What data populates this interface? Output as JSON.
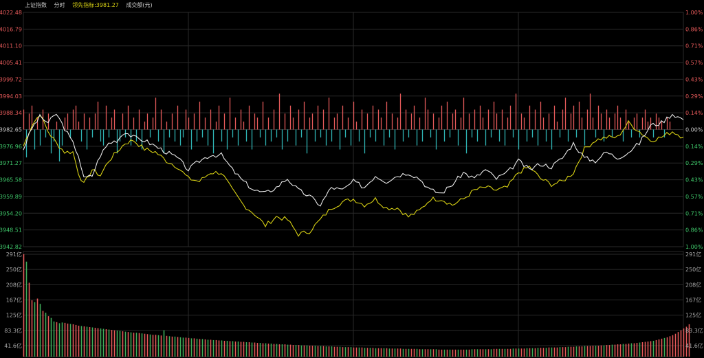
{
  "header": {
    "index_name": "上证指数",
    "mode": "分时",
    "leader_label": "领先指标:",
    "leader_value": "3981.27",
    "volume_label": "成交额(元)"
  },
  "colors": {
    "up": "#e65a5a",
    "down": "#2fb4b4",
    "neutral": "#cccccc",
    "price_line": "#e8e8e8",
    "leader_line": "#d9d214",
    "grid": "#2a2a2a",
    "header_text": "#cccccc",
    "leader_text": "#d9d214"
  },
  "chart_data": [
    {
      "type": "line",
      "name": "intraday",
      "prev_close": 3982.65,
      "ylim": [
        3942.82,
        4022.48
      ],
      "y_ticks_left": [
        "4022.48",
        "4016.79",
        "4011.10",
        "4005.41",
        "3999.72",
        "3994.03",
        "3988.34",
        "3982.65",
        "3976.96",
        "3971.27",
        "3965.58",
        "3959.89",
        "3954.20",
        "3948.51",
        "3942.82"
      ],
      "y_ticks_right": [
        "1.00%",
        "0.86%",
        "0.71%",
        "0.57%",
        "0.43%",
        "0.29%",
        "0.14%",
        "0.00%",
        "0.14%",
        "0.29%",
        "0.43%",
        "0.57%",
        "0.71%",
        "0.86%",
        "1.00%"
      ],
      "price_anchors": [
        [
          0,
          3976
        ],
        [
          3,
          3983
        ],
        [
          6,
          3987
        ],
        [
          9,
          3985
        ],
        [
          12,
          3988
        ],
        [
          15,
          3983
        ],
        [
          18,
          3978
        ],
        [
          20,
          3974
        ],
        [
          22,
          3966
        ],
        [
          25,
          3967
        ],
        [
          28,
          3974
        ],
        [
          31,
          3978
        ],
        [
          34,
          3979
        ],
        [
          37,
          3982
        ],
        [
          40,
          3980
        ],
        [
          44,
          3979
        ],
        [
          48,
          3977
        ],
        [
          52,
          3975
        ],
        [
          56,
          3973
        ],
        [
          60,
          3969
        ],
        [
          64,
          3972
        ],
        [
          68,
          3974
        ],
        [
          72,
          3974
        ],
        [
          76,
          3969
        ],
        [
          80,
          3965
        ],
        [
          84,
          3962
        ],
        [
          88,
          3961
        ],
        [
          92,
          3963
        ],
        [
          96,
          3966
        ],
        [
          100,
          3962
        ],
        [
          104,
          3960
        ],
        [
          108,
          3957
        ],
        [
          112,
          3963
        ],
        [
          116,
          3962
        ],
        [
          120,
          3965
        ],
        [
          124,
          3963
        ],
        [
          128,
          3967
        ],
        [
          132,
          3965
        ],
        [
          136,
          3967
        ],
        [
          140,
          3968
        ],
        [
          144,
          3966
        ],
        [
          148,
          3962
        ],
        [
          152,
          3961
        ],
        [
          156,
          3964
        ],
        [
          160,
          3968
        ],
        [
          164,
          3966
        ],
        [
          168,
          3969
        ],
        [
          172,
          3966
        ],
        [
          176,
          3968
        ],
        [
          180,
          3972
        ],
        [
          184,
          3969
        ],
        [
          188,
          3971
        ],
        [
          192,
          3970
        ],
        [
          196,
          3973
        ],
        [
          200,
          3978
        ],
        [
          204,
          3973
        ],
        [
          208,
          3972
        ],
        [
          212,
          3975
        ],
        [
          216,
          3973
        ],
        [
          220,
          3975
        ],
        [
          224,
          3978
        ],
        [
          228,
          3984
        ],
        [
          232,
          3985
        ],
        [
          236,
          3988
        ],
        [
          240,
          3986
        ]
      ],
      "leader_anchors": [
        [
          0,
          3977
        ],
        [
          3,
          3984
        ],
        [
          6,
          3988
        ],
        [
          9,
          3982
        ],
        [
          12,
          3978
        ],
        [
          15,
          3975
        ],
        [
          18,
          3975
        ],
        [
          20,
          3968
        ],
        [
          22,
          3964
        ],
        [
          25,
          3969
        ],
        [
          28,
          3967
        ],
        [
          31,
          3972
        ],
        [
          34,
          3975
        ],
        [
          37,
          3978
        ],
        [
          40,
          3979
        ],
        [
          44,
          3976
        ],
        [
          48,
          3975
        ],
        [
          52,
          3972
        ],
        [
          56,
          3970
        ],
        [
          60,
          3966
        ],
        [
          64,
          3965
        ],
        [
          68,
          3968
        ],
        [
          72,
          3968
        ],
        [
          76,
          3962
        ],
        [
          80,
          3957
        ],
        [
          84,
          3954
        ],
        [
          88,
          3950
        ],
        [
          92,
          3953
        ],
        [
          96,
          3952
        ],
        [
          100,
          3947
        ],
        [
          104,
          3948
        ],
        [
          108,
          3952
        ],
        [
          112,
          3956
        ],
        [
          116,
          3958
        ],
        [
          120,
          3959
        ],
        [
          124,
          3957
        ],
        [
          128,
          3959
        ],
        [
          132,
          3956
        ],
        [
          136,
          3956
        ],
        [
          140,
          3953
        ],
        [
          144,
          3955
        ],
        [
          148,
          3959
        ],
        [
          152,
          3959
        ],
        [
          156,
          3957
        ],
        [
          160,
          3959
        ],
        [
          164,
          3962
        ],
        [
          168,
          3963
        ],
        [
          172,
          3962
        ],
        [
          176,
          3963
        ],
        [
          180,
          3968
        ],
        [
          184,
          3970
        ],
        [
          188,
          3966
        ],
        [
          192,
          3964
        ],
        [
          196,
          3965
        ],
        [
          200,
          3968
        ],
        [
          204,
          3976
        ],
        [
          208,
          3979
        ],
        [
          212,
          3980
        ],
        [
          216,
          3980
        ],
        [
          220,
          3985
        ],
        [
          224,
          3982
        ],
        [
          228,
          3979
        ],
        [
          232,
          3980
        ],
        [
          236,
          3982
        ],
        [
          240,
          3980
        ]
      ],
      "breadth_bars": [
        0.5,
        -0.7,
        0.4,
        0.6,
        -0.5,
        0.3,
        -0.4,
        0.5,
        -0.2,
        0.4,
        -0.6,
        -0.3,
        0.2,
        -0.8,
        -0.4,
        0.3,
        0.4,
        -0.2,
        0.5,
        0.6,
        0.2,
        -0.3,
        0.4,
        -0.5,
        0.3,
        -0.2,
        0.4,
        0.7,
        -0.3,
        -0.4,
        0.6,
        -0.2,
        0.3,
        0.5,
        -0.6,
        -0.3,
        0.4,
        -0.2,
        0.6,
        -0.4,
        0.3,
        -0.3,
        0.5,
        -0.5,
        0.2,
        0.4,
        -0.2,
        0.3,
        0.8,
        -0.3,
        0.5,
        -0.6,
        0.2,
        -0.2,
        0.4,
        -0.3,
        0.6,
        -0.4,
        -0.2,
        0.5,
        0.3,
        -0.5,
        0.4,
        -0.3,
        0.7,
        -0.2,
        0.3,
        -0.4,
        0.5,
        -0.6,
        0.2,
        0.6,
        -0.3,
        0.4,
        -0.5,
        0.8,
        -0.2,
        0.3,
        -0.4,
        0.5,
        0.2,
        -0.3,
        0.6,
        -0.5,
        0.4,
        0.3,
        -0.2,
        0.7,
        -0.4,
        0.3,
        -0.3,
        0.5,
        -0.2,
        0.9,
        -0.5,
        0.4,
        -0.3,
        0.6,
        0.3,
        -0.4,
        0.5,
        -0.2,
        0.7,
        -0.6,
        0.3,
        0.4,
        -0.3,
        0.6,
        -0.2,
        0.5,
        -0.4,
        0.8,
        -0.3,
        0.3,
        0.4,
        -0.5,
        0.6,
        -0.2,
        0.3,
        -0.4,
        0.7,
        0.2,
        -0.3,
        0.5,
        -0.6,
        0.4,
        -0.2,
        0.6,
        -0.3,
        0.5,
        0.3,
        -0.4,
        0.7,
        -0.2,
        0.4,
        -0.5,
        0.3,
        0.9,
        -0.3,
        0.5,
        -0.2,
        0.4,
        0.6,
        -0.4,
        0.3,
        -0.3,
        0.8,
        0.5,
        -0.2,
        0.4,
        -0.5,
        0.3,
        0.6,
        -0.3,
        0.7,
        -0.2,
        0.4,
        0.5,
        -0.4,
        0.3,
        0.8,
        -0.6,
        0.4,
        -0.2,
        0.5,
        -0.3,
        0.6,
        0.3,
        -0.4,
        0.5,
        -0.2,
        0.7,
        0.4,
        -0.3,
        0.5,
        -0.4,
        0.3,
        0.6,
        -0.2,
        0.9,
        -0.5,
        0.4,
        0.3,
        -0.3,
        0.6,
        -0.2,
        0.5,
        -0.4,
        0.7,
        0.3,
        -0.3,
        0.4,
        -0.5,
        0.6,
        0.2,
        -0.2,
        0.5,
        0.8,
        -0.3,
        0.4,
        0.6,
        -0.2,
        0.7,
        0.3,
        -0.4,
        0.5,
        0.9,
        0.3,
        -0.2,
        0.6,
        0.4,
        -0.3,
        0.5,
        0.3,
        -0.2,
        0.4,
        0.6,
        0.3,
        -0.3,
        0.5,
        0.2,
        -0.2,
        0.3,
        0.4,
        -0.2,
        0.3,
        0.5,
        0.2,
        0.3,
        -0.2,
        0.4,
        0.3,
        0.2,
        -0.2,
        0.3,
        0.2
      ]
    },
    {
      "type": "bar",
      "name": "volume",
      "y_ticks_left": [
        "291亿",
        "250亿",
        "208亿",
        "167亿",
        "125亿",
        "83.3亿",
        "41.6亿"
      ],
      "y_ticks_right": [
        "291亿",
        "250亿",
        "208亿",
        "167亿",
        "125亿",
        "83.3亿",
        "41.6亿"
      ],
      "ylim": [
        0,
        291
      ],
      "values": [
        291,
        270,
        210,
        160,
        155,
        165,
        150,
        130,
        125,
        115,
        110,
        100,
        98,
        95,
        97,
        96,
        94,
        93,
        92,
        90,
        88,
        87,
        86,
        85,
        84,
        83,
        82,
        81,
        80,
        79,
        78,
        77,
        76,
        75,
        74,
        73,
        72,
        71,
        70,
        69,
        68,
        68,
        67,
        66,
        65,
        64,
        63,
        62,
        62,
        61,
        60,
        75,
        59,
        58,
        57,
        57,
        56,
        55,
        54,
        54,
        53,
        52,
        52,
        51,
        50,
        50,
        49,
        48,
        48,
        47,
        47,
        46,
        46,
        45,
        45,
        44,
        44,
        43,
        43,
        42,
        42,
        41,
        41,
        40,
        40,
        39,
        39,
        38,
        38,
        37,
        37,
        36,
        36,
        35,
        35,
        35,
        34,
        34,
        33,
        33,
        33,
        32,
        32,
        32,
        31,
        31,
        31,
        30,
        30,
        30,
        29,
        29,
        29,
        28,
        28,
        28,
        27,
        27,
        27,
        27,
        26,
        26,
        26,
        26,
        25,
        25,
        25,
        25,
        24,
        24,
        24,
        24,
        24,
        23,
        23,
        23,
        23,
        23,
        22,
        22,
        22,
        22,
        22,
        22,
        21,
        21,
        21,
        21,
        21,
        21,
        21,
        20,
        20,
        20,
        20,
        20,
        20,
        20,
        20,
        20,
        20,
        20,
        20,
        21,
        21,
        21,
        21,
        21,
        21,
        21,
        21,
        22,
        22,
        22,
        22,
        22,
        22,
        22,
        23,
        23,
        23,
        23,
        23,
        24,
        24,
        24,
        24,
        25,
        25,
        25,
        25,
        26,
        26,
        26,
        26,
        27,
        27,
        27,
        28,
        28,
        28,
        29,
        29,
        29,
        30,
        30,
        30,
        31,
        31,
        31,
        32,
        32,
        33,
        33,
        34,
        34,
        35,
        35,
        36,
        36,
        37,
        38,
        38,
        39,
        40,
        41,
        42,
        43,
        44,
        45,
        47,
        49,
        51,
        53,
        55,
        58,
        61,
        65,
        70,
        75,
        80,
        85,
        92
      ]
    }
  ]
}
